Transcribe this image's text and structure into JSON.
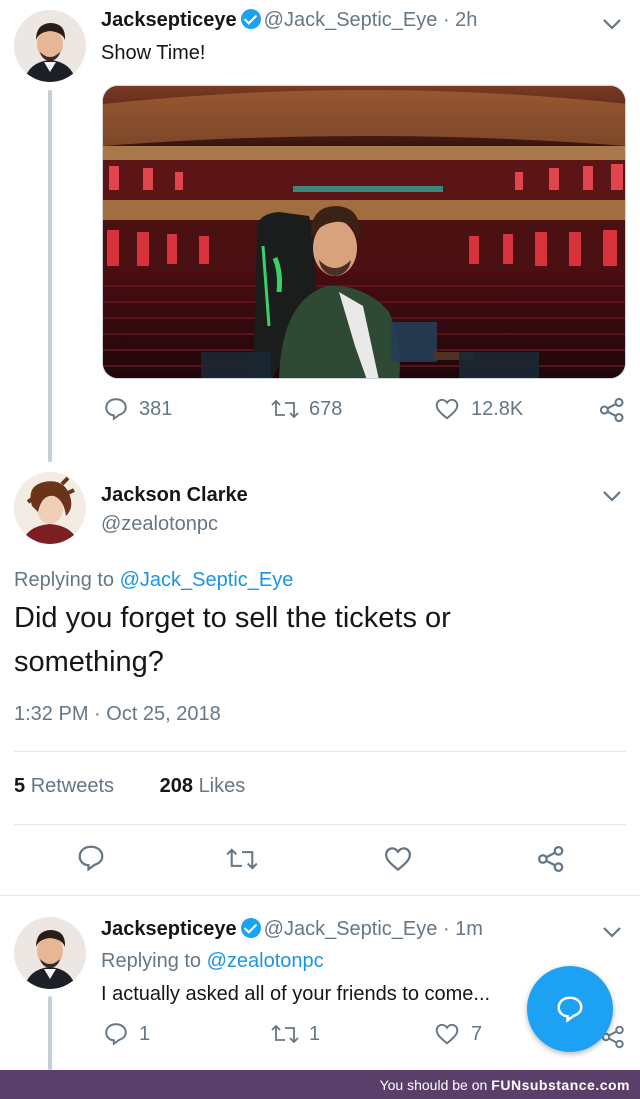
{
  "tweet1": {
    "name": "Jacksepticeye",
    "handle": "@Jack_Septic_Eye · 2h",
    "text": "Show Time!",
    "replies": "381",
    "retweets": "678",
    "likes": "12.8K"
  },
  "tweet2": {
    "name": "Jackson Clarke",
    "handle": "@zealotonpc",
    "replying_prefix": "Replying to ",
    "replying_to": "@Jack_Septic_Eye",
    "text_line1": "Did you forget to sell the tickets or",
    "text_line2": "something?",
    "timestamp": "1:32 PM · Oct 25, 2018",
    "retweets_count": "5",
    "retweets_label": "Retweets",
    "likes_count": "208",
    "likes_label": "Likes"
  },
  "tweet3": {
    "name": "Jacksepticeye",
    "handle": "@Jack_Septic_Eye · 1m",
    "replying_prefix": "Replying to ",
    "replying_to": "@zealotonpc",
    "text": "I actually asked all of your friends to come...",
    "replies": "1",
    "retweets": "1",
    "likes": "7"
  },
  "footer": {
    "prefix": "You should be on",
    "brand": "FUNsubstance.com"
  },
  "colors": {
    "accent": "#1da1f2",
    "link": "#1b95e0",
    "muted": "#657786",
    "footer_bg": "#5b3f6b"
  }
}
